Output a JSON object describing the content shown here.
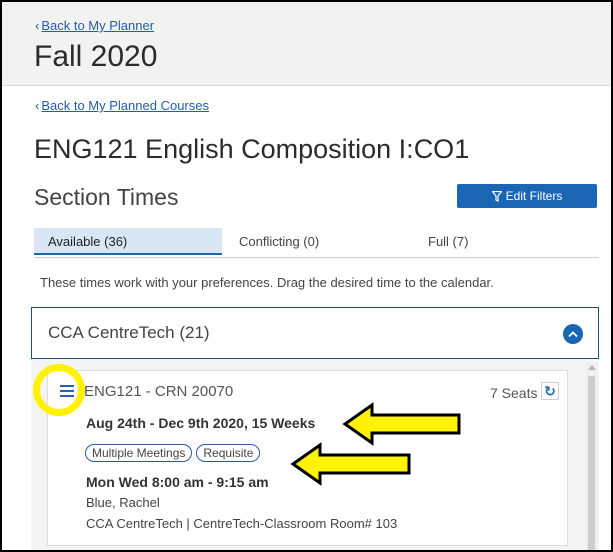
{
  "header": {
    "back_planner": "Back to My Planner",
    "term": "Fall 2020"
  },
  "course": {
    "back_courses": "Back to My Planned Courses",
    "title": "ENG121 English Composition I:CO1"
  },
  "section": {
    "title": "Section Times",
    "edit_filters": "Edit Filters"
  },
  "tabs": [
    {
      "label": "Available (36)",
      "active": true
    },
    {
      "label": "Conflicting (0)",
      "active": false
    },
    {
      "label": "Full (7)",
      "active": false
    }
  ],
  "preference_text": "These times work with your preferences. Drag the desired time to the calendar.",
  "campus": {
    "name": "CCA CentreTech (21)"
  },
  "card": {
    "crn_title": "ENG121 - CRN 20070",
    "seats": "7 Seats",
    "dates": "Aug 24th - Dec 9th 2020, 15 Weeks",
    "tags": [
      "Multiple Meetings",
      "Requisite"
    ],
    "meeting_time": "Mon Wed 8:00 am - 9:15 am",
    "instructor": "Blue, Rachel",
    "location": "CCA CentreTech | CentreTech-Classroom Room# 103"
  },
  "colors": {
    "accent": "#1a66b3",
    "highlight": "#fff200",
    "link": "#1f5fa8"
  }
}
